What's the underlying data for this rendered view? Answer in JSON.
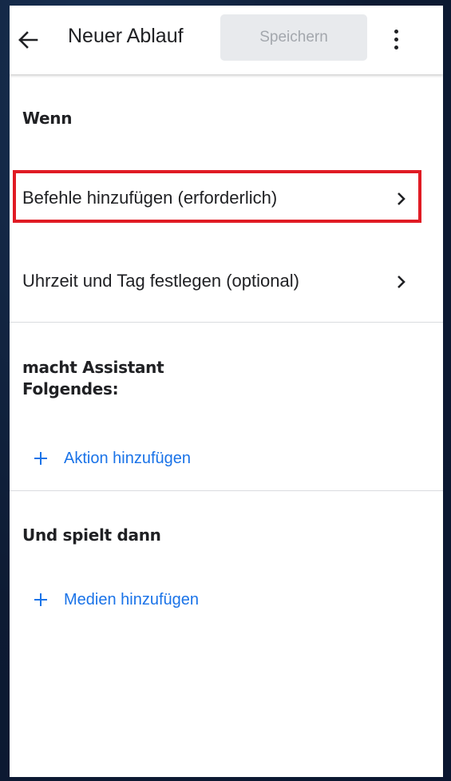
{
  "appbar": {
    "title": "Neuer Ablauf",
    "save_label": "Speichern",
    "back_icon": "arrow-back-icon",
    "more_icon": "more-vert-icon"
  },
  "section_when": {
    "heading": "Wenn",
    "items": [
      {
        "label": "Befehle hinzufügen (erforderlich)",
        "icon": "chevron-right-icon",
        "highlighted": true
      },
      {
        "label": "Uhrzeit und Tag festlegen (optional)",
        "icon": "chevron-right-icon",
        "highlighted": false
      }
    ]
  },
  "section_actions": {
    "heading_line1": "macht Assistant",
    "heading_line2": "Folgendes:",
    "add_label": "Aktion hinzufügen"
  },
  "section_media": {
    "heading": "Und spielt dann",
    "add_label": "Medien hinzufügen"
  },
  "colors": {
    "accent": "#1a73e8",
    "highlight": "#e01b24",
    "text": "#202124",
    "disabled_button_bg": "#e8eaed",
    "disabled_button_text": "#a3a7ad",
    "divider": "#dadce0",
    "background": "#0d1b33"
  }
}
